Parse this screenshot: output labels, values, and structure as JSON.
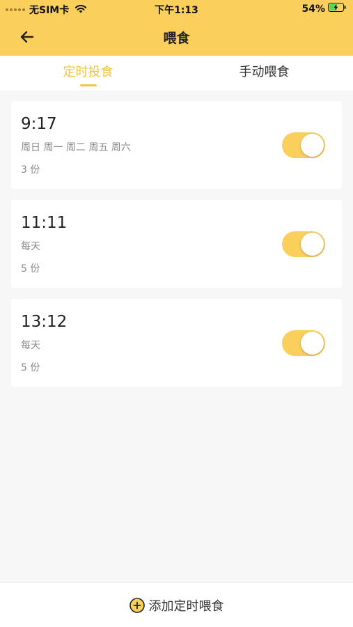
{
  "status_bar": {
    "carrier": "无SIM卡",
    "time": "下午1:13",
    "battery": "54%"
  },
  "nav": {
    "title": "喂食",
    "back_icon": "arrow-left-icon"
  },
  "tabs": [
    {
      "label": "定时投食",
      "active": true
    },
    {
      "label": "手动喂食",
      "active": false
    }
  ],
  "schedules": [
    {
      "time": "9:17",
      "repeat": "周日 周一 周二 周五 周六",
      "portion": "3 份",
      "enabled": true
    },
    {
      "time": "11:11",
      "repeat": "每天",
      "portion": "5 份",
      "enabled": true
    },
    {
      "time": "13:12",
      "repeat": "每天",
      "portion": "5 份",
      "enabled": true
    }
  ],
  "bottom": {
    "add_label": "添加定时喂食",
    "add_icon": "plus-circle-icon"
  },
  "colors": {
    "accent": "#fbcf5b",
    "active_tab": "#f5c342"
  }
}
